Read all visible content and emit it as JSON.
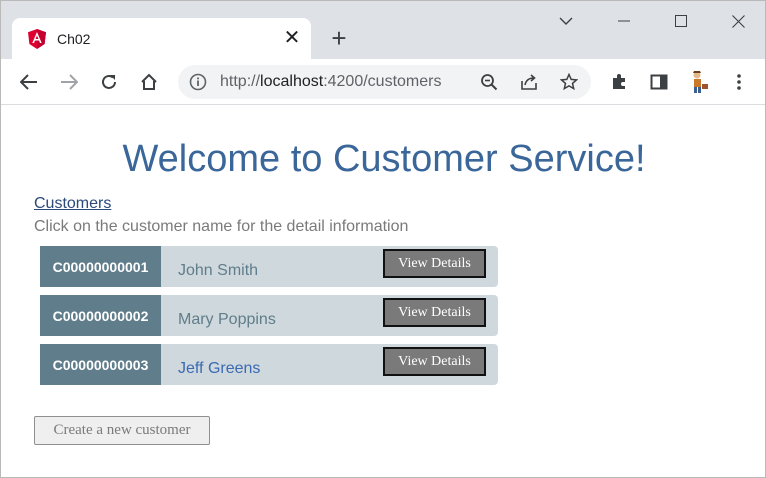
{
  "browser": {
    "tab_title": "Ch02",
    "tab_close": "✕",
    "new_tab": "+",
    "url_scheme": "http://",
    "url_host": "localhost",
    "url_rest": ":4200/customers",
    "icons": [
      "angular-favicon",
      "close-icon",
      "new-tab-icon",
      "chevron-down-icon",
      "minimize-icon",
      "maximize-icon",
      "window-close-icon",
      "back-icon",
      "forward-icon",
      "reload-icon",
      "home-icon",
      "info-icon",
      "zoom-icon",
      "share-icon",
      "star-icon",
      "extensions-icon",
      "side-panel-icon",
      "profile-avatar",
      "menu-icon"
    ]
  },
  "page": {
    "title": "Welcome to Customer Service!",
    "customers_link": "Customers",
    "hint": "Click on the customer name for the detail information",
    "view_label": "View Details",
    "create_label": "Create a new customer",
    "customers": [
      {
        "id": "C00000000001",
        "name": "John Smith",
        "active": false
      },
      {
        "id": "C00000000002",
        "name": "Mary Poppins",
        "active": false
      },
      {
        "id": "C00000000003",
        "name": "Jeff Greens",
        "active": true
      }
    ],
    "colors": {
      "title": "#3a6699",
      "id_bg": "#607d8b",
      "row_bg": "#cfd8dc",
      "button_bg": "#7a7a7a"
    }
  }
}
